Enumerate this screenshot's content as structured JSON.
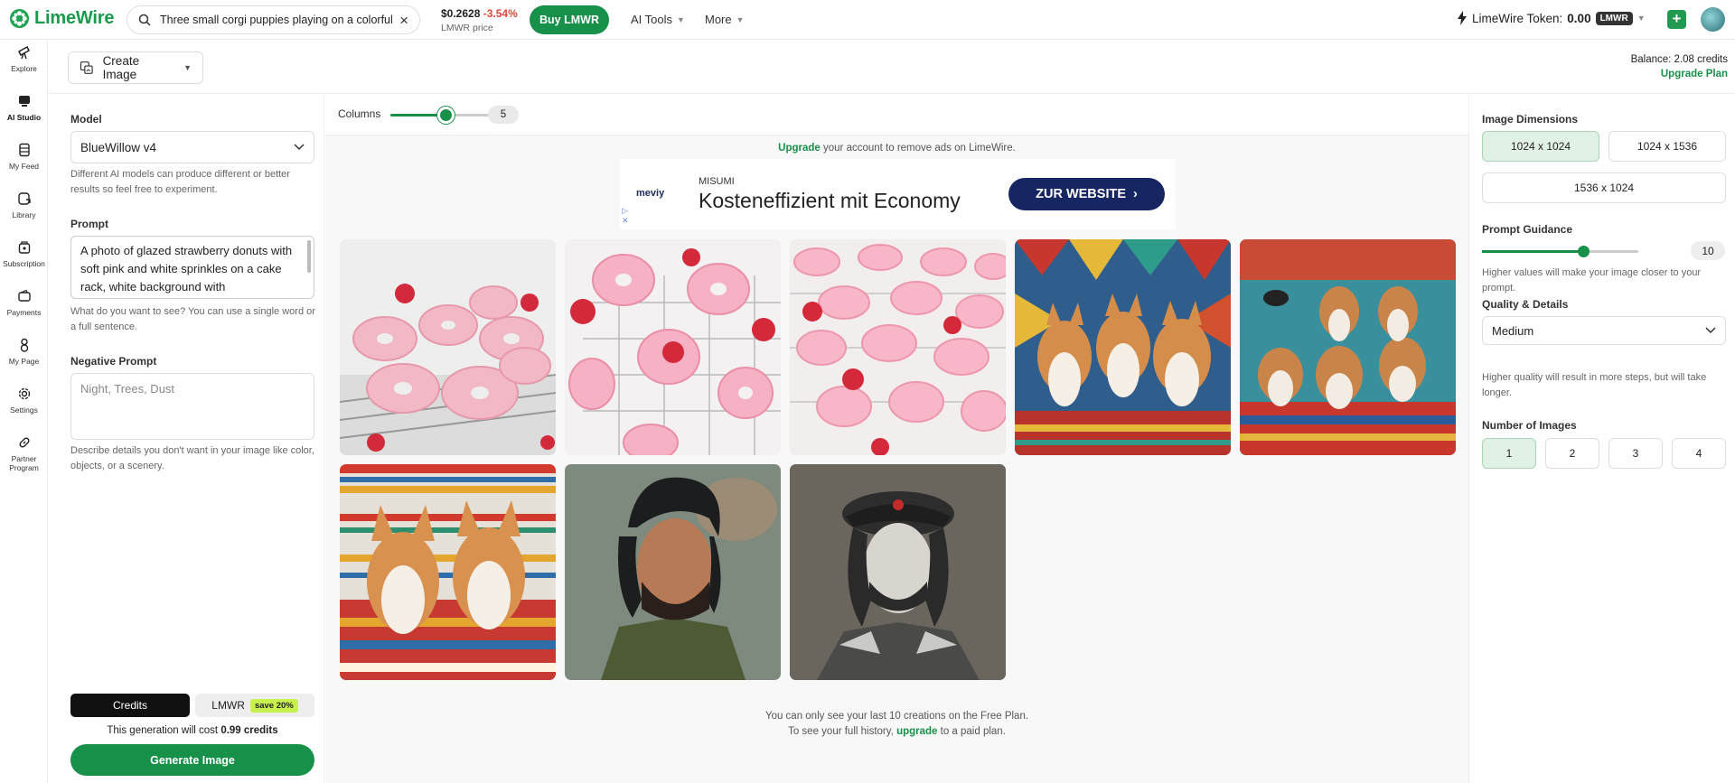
{
  "app": {
    "name": "LimeWire"
  },
  "topbar": {
    "search_value": "Three small corgi puppies playing on a colorful",
    "price": "$0.2628",
    "price_change": "-3.54%",
    "price_label": "LMWR price",
    "buy_label": "Buy LMWR",
    "nav": [
      {
        "label": "AI Tools"
      },
      {
        "label": "More"
      }
    ],
    "token_label": "LimeWire Token:",
    "token_value": "0.00",
    "token_unit": "LMWR"
  },
  "sidebar": {
    "items": [
      {
        "label": "Explore",
        "icon": "telescope-icon"
      },
      {
        "label": "AI Studio",
        "icon": "monitor-icon"
      },
      {
        "label": "My Feed",
        "icon": "feed-icon"
      },
      {
        "label": "Library",
        "icon": "library-icon"
      },
      {
        "label": "Subscription",
        "icon": "subscription-icon"
      },
      {
        "label": "Payments",
        "icon": "wallet-icon"
      },
      {
        "label": "My Page",
        "icon": "user-icon"
      },
      {
        "label": "Settings",
        "icon": "gear-icon"
      },
      {
        "label": "Partner Program",
        "icon": "link-icon"
      }
    ]
  },
  "subheader": {
    "mode_label": "Create Image",
    "balance": "Balance: 2.08 credits",
    "upgrade": "Upgrade Plan"
  },
  "left": {
    "model_label": "Model",
    "model_value": "BlueWillow v4",
    "model_help": "Different AI models can produce different or better results so feel free to experiment.",
    "prompt_label": "Prompt",
    "prompt_value": "A photo of glazed strawberry donuts with soft pink and white sprinkles on a cake rack, white background with",
    "prompt_help": "What do you want to see? You can use a single word or a full sentence.",
    "neg_label": "Negative Prompt",
    "neg_placeholder": "Night, Trees, Dust",
    "neg_help": "Describe details you don't want in your image like color, objects, or a scenery.",
    "pay_credits": "Credits",
    "pay_lmwr": "LMWR",
    "save_badge": "save 20%",
    "cost_prefix": "This generation will cost",
    "cost_value": "0.99 credits",
    "generate_label": "Generate Image"
  },
  "main": {
    "columns_label": "Columns",
    "columns_value": "5",
    "columns_fraction": 0.55,
    "upgrade_link": "Upgrade",
    "upgrade_rest": "your account to remove ads on LimeWire.",
    "ad": {
      "logo": "meviy",
      "brand": "MISUMI",
      "headline": "Kosteneffizient mit Economy",
      "cta": "ZUR WEBSITE"
    },
    "images": [
      {
        "name": "donuts-image-1"
      },
      {
        "name": "donuts-image-2"
      },
      {
        "name": "donuts-image-3"
      },
      {
        "name": "corgis-image-1"
      },
      {
        "name": "corgis-image-2"
      },
      {
        "name": "corgis-image-3"
      },
      {
        "name": "portrait-image-1"
      },
      {
        "name": "portrait-image-2"
      }
    ],
    "note_line1": "You can only see your last 10 creations on the Free Plan.",
    "note_line2_prefix": "To see your full history,",
    "note_line2_link": "upgrade",
    "note_line2_suffix": "to a paid plan."
  },
  "right": {
    "dimensions_label": "Image Dimensions",
    "dimensions": [
      {
        "label": "1024 x 1024",
        "selected": true
      },
      {
        "label": "1024 x 1536",
        "selected": false
      },
      {
        "label": "1536 x 1024",
        "selected": false
      }
    ],
    "guidance_label": "Prompt Guidance",
    "guidance_value": "10",
    "guidance_fraction": 0.65,
    "guidance_help": "Higher values will make your image closer to your prompt.",
    "quality_label": "Quality & Details",
    "quality_value": "Medium",
    "quality_help": "Higher quality will result in more steps, but will take longer.",
    "count_label": "Number of Images",
    "counts": [
      {
        "label": "1",
        "selected": true
      },
      {
        "label": "2",
        "selected": false
      },
      {
        "label": "3",
        "selected": false
      },
      {
        "label": "4",
        "selected": false
      }
    ]
  },
  "colors": {
    "accent": "#17914a",
    "ad_cta": "#152663",
    "negative": "#e0483c"
  }
}
